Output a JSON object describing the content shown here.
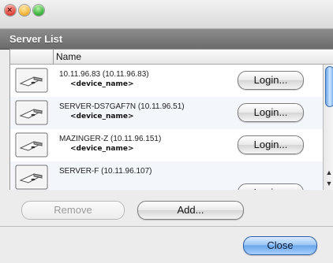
{
  "window": {
    "title": ""
  },
  "section": {
    "title": "Server List"
  },
  "list": {
    "column_name": "Name",
    "rows": [
      {
        "title": "10.11.96.83 (10.11.96.83)",
        "sub": "<device_name>",
        "button": "Login..."
      },
      {
        "title": "SERVER-DS7GAF7N (10.11.96.51)",
        "sub": "<device_name>",
        "button": "Login..."
      },
      {
        "title": "MAZINGER-Z (10.11.96.151)",
        "sub": "<device_name>",
        "button": "Login..."
      },
      {
        "title": "SERVER-F (10.11.96.107)",
        "sub": "",
        "button": "Login..."
      }
    ]
  },
  "actions": {
    "remove": "Remove",
    "add": "Add...",
    "close": "Close"
  }
}
